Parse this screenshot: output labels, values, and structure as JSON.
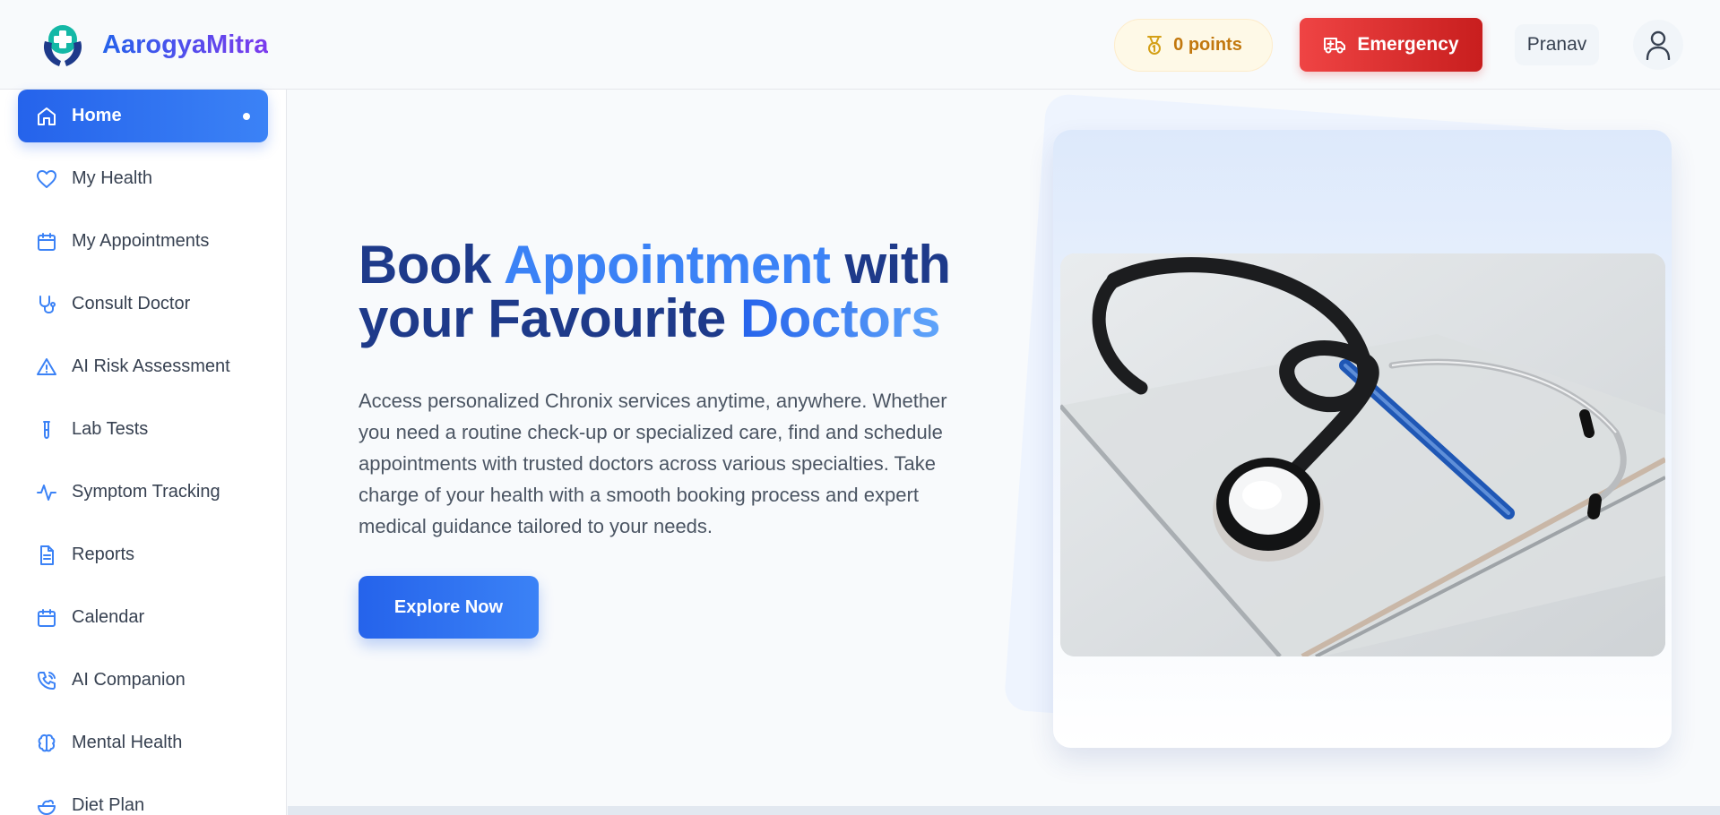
{
  "app": {
    "name": "AarogyaMitra"
  },
  "header": {
    "points_label": "0 points",
    "emergency_label": "Emergency",
    "user_name": "Pranav"
  },
  "sidebar": {
    "items": [
      {
        "label": "Home",
        "icon": "home-icon",
        "active": true
      },
      {
        "label": "My Health",
        "icon": "heart-icon"
      },
      {
        "label": "My Appointments",
        "icon": "calendar-icon"
      },
      {
        "label": "Consult Doctor",
        "icon": "stethoscope-icon"
      },
      {
        "label": "AI Risk Assessment",
        "icon": "warning-icon"
      },
      {
        "label": "Lab Tests",
        "icon": "test-tube-icon"
      },
      {
        "label": "Symptom Tracking",
        "icon": "activity-icon"
      },
      {
        "label": "Reports",
        "icon": "document-icon"
      },
      {
        "label": "Calendar",
        "icon": "calendar-icon"
      },
      {
        "label": "AI Companion",
        "icon": "phone-icon"
      },
      {
        "label": "Mental Health",
        "icon": "brain-icon"
      },
      {
        "label": "Diet Plan",
        "icon": "salad-icon"
      }
    ]
  },
  "hero": {
    "title_part1": "Book ",
    "title_accent": "Appointment",
    "title_part2": " with your Favourite ",
    "title_accent2": "Doctors",
    "description": "Access personalized Chronix services anytime, anywhere. Whether you need a routine check-up or specialized care, find and schedule appointments with trusted doctors across various specialties. Take charge of your health with a smooth booking process and expert medical guidance tailored to your needs.",
    "cta_label": "Explore Now",
    "image": "stethoscope-on-notebook-photo"
  },
  "colors": {
    "primary": "#2563eb",
    "heading": "#1e3a8a",
    "emergency": "#dc2626",
    "points": "#c2780e"
  }
}
